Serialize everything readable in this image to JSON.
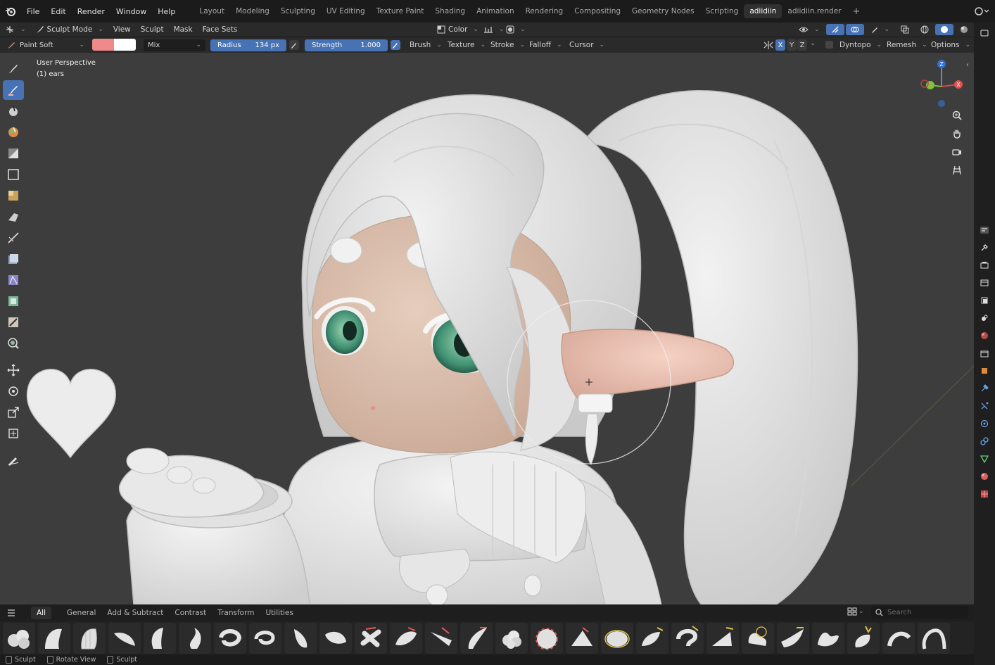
{
  "menu": {
    "items": [
      "File",
      "Edit",
      "Render",
      "Window",
      "Help"
    ]
  },
  "workspaces": {
    "tabs": [
      "Layout",
      "Modeling",
      "Sculpting",
      "UV Editing",
      "Texture Paint",
      "Shading",
      "Animation",
      "Rendering",
      "Compositing",
      "Geometry Nodes",
      "Scripting",
      "adiidiin",
      "adiidiin.render"
    ],
    "active": "adiidiin",
    "add_label": "+"
  },
  "header": {
    "mode": "Sculpt Mode",
    "view": "View",
    "sculpt": "Sculpt",
    "mask": "Mask",
    "face_sets": "Face Sets",
    "color_label": "Color"
  },
  "tool_settings": {
    "brush_name": "Paint Soft",
    "primary_color": "#f08a8a",
    "secondary_color": "#ffffff",
    "blend": "Mix",
    "radius_label": "Radius",
    "radius_value": "134 px",
    "strength_label": "Strength",
    "strength_value": "1.000",
    "brush": "Brush",
    "texture": "Texture",
    "stroke": "Stroke",
    "falloff": "Falloff",
    "cursor": "Cursor",
    "axis_x": "X",
    "axis_y": "Y",
    "axis_z": "Z",
    "dyntopo": "Dyntopo",
    "remesh": "Remesh",
    "options": "Options"
  },
  "viewport": {
    "perspective": "User Perspective",
    "object": "(1) ears"
  },
  "gizmo": {
    "z": "Z",
    "x": "X"
  },
  "brush_categories": {
    "tabs": [
      "All",
      "General",
      "Add & Subtract",
      "Contrast",
      "Transform",
      "Utilities"
    ],
    "active": "All",
    "search_placeholder": "Search"
  },
  "status": {
    "items": [
      "Sculpt",
      "Rotate View",
      "Sculpt"
    ]
  },
  "colors": {
    "accent": "#4772b3",
    "viewport_bg": "#3d3d3d",
    "skin": "#dcc0ae"
  }
}
